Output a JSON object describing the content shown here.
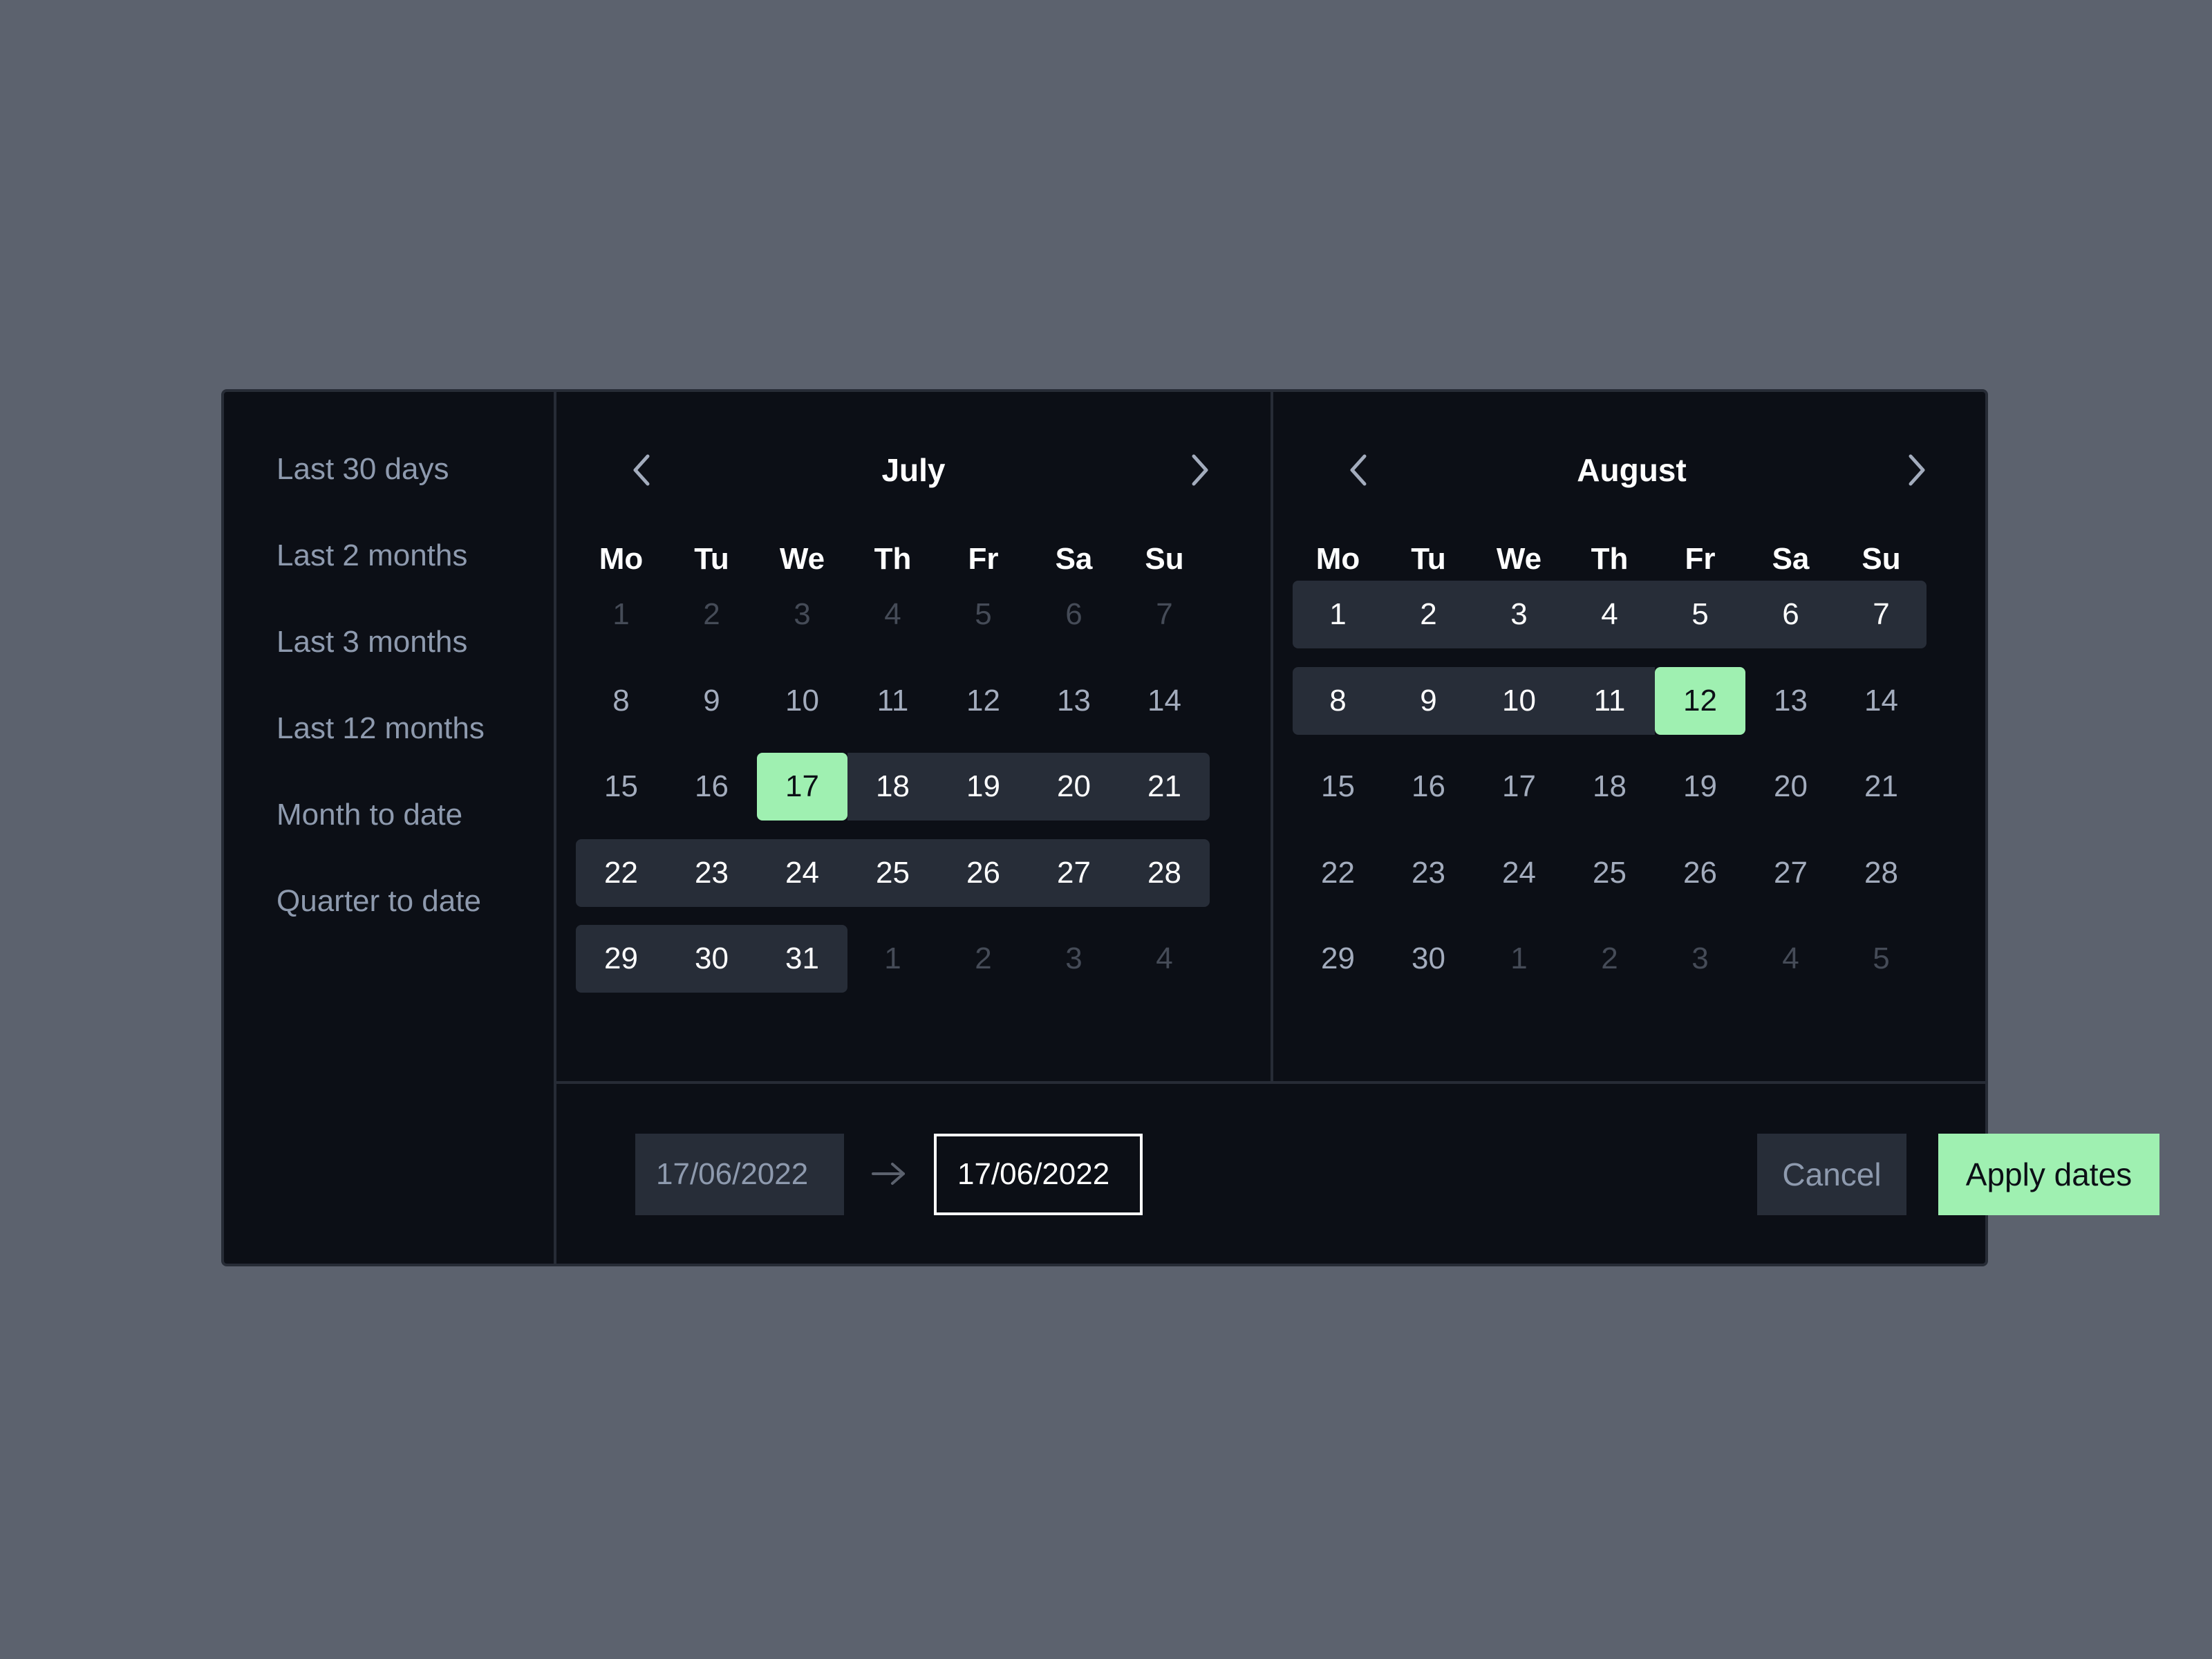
{
  "presets": [
    "Last 30 days",
    "Last 2 months",
    "Last 3 months",
    "Last 12 months",
    "Month to date",
    "Quarter to date"
  ],
  "weekdays": [
    "Mo",
    "Tu",
    "We",
    "Th",
    "Fr",
    "Sa",
    "Su"
  ],
  "months": [
    {
      "title": "July",
      "days": [
        [
          "1",
          "2",
          "3",
          "4",
          "5",
          "6",
          "7"
        ],
        [
          "8",
          "9",
          "10",
          "11",
          "12",
          "13",
          "14"
        ],
        [
          "15",
          "16",
          "17",
          "18",
          "19",
          "20",
          "21"
        ],
        [
          "22",
          "23",
          "24",
          "25",
          "26",
          "27",
          "28"
        ],
        [
          "29",
          "30",
          "31",
          "1",
          "2",
          "3",
          "4"
        ]
      ],
      "muted_rows": [
        0
      ],
      "trailing_muted_from": [
        4,
        3
      ],
      "selected": [
        2,
        2
      ],
      "range_rows": [
        [
          2,
          2,
          6
        ],
        [
          3,
          0,
          6
        ],
        [
          4,
          0,
          2
        ]
      ]
    },
    {
      "title": "August",
      "days": [
        [
          "1",
          "2",
          "3",
          "4",
          "5",
          "6",
          "7"
        ],
        [
          "8",
          "9",
          "10",
          "11",
          "12",
          "13",
          "14"
        ],
        [
          "15",
          "16",
          "17",
          "18",
          "19",
          "20",
          "21"
        ],
        [
          "22",
          "23",
          "24",
          "25",
          "26",
          "27",
          "28"
        ],
        [
          "29",
          "30",
          "1",
          "2",
          "3",
          "4",
          "5"
        ]
      ],
      "muted_rows": [],
      "trailing_muted_from": [
        4,
        2
      ],
      "selected": [
        1,
        4
      ],
      "range_rows": [
        [
          0,
          0,
          6
        ],
        [
          1,
          0,
          4
        ]
      ]
    }
  ],
  "footer": {
    "from_value": "17/06/2022",
    "to_value": "17/06/2022",
    "cancel_label": "Cancel",
    "apply_label": "Apply dates"
  },
  "colors": {
    "accent": "#9ff0b1",
    "panel": "#0c0f16",
    "range": "#272d38",
    "backdrop": "#5c626e"
  },
  "icons": {
    "prev": "chevron-left-icon",
    "next": "chevron-right-icon",
    "arrow": "arrow-right-icon"
  }
}
